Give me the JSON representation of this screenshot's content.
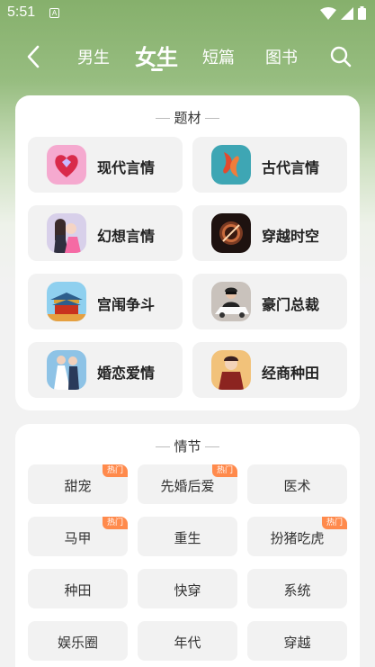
{
  "status_bar": {
    "time": "5:51",
    "app_badge": "A"
  },
  "nav": {
    "tabs": [
      {
        "label": "男生"
      },
      {
        "label": "女生"
      },
      {
        "label": "短篇"
      },
      {
        "label": "图书"
      }
    ],
    "active_tab": "女生"
  },
  "topics": {
    "title": "题材",
    "items": [
      {
        "label": "现代言情",
        "icon": "heart-gem-icon"
      },
      {
        "label": "古代言情",
        "icon": "koi-fish-icon"
      },
      {
        "label": "幻想言情",
        "icon": "couple-icon"
      },
      {
        "label": "穿越时空",
        "icon": "time-portal-icon"
      },
      {
        "label": "宫闱争斗",
        "icon": "palace-icon"
      },
      {
        "label": "豪门总裁",
        "icon": "ceo-car-icon"
      },
      {
        "label": "婚恋爱情",
        "icon": "wedding-icon"
      },
      {
        "label": "经商种田",
        "icon": "merchant-icon"
      }
    ]
  },
  "plots": {
    "title": "情节",
    "hot_label": "热门",
    "items": [
      {
        "label": "甜宠",
        "hot": true
      },
      {
        "label": "先婚后爱",
        "hot": true
      },
      {
        "label": "医术",
        "hot": false
      },
      {
        "label": "马甲",
        "hot": true
      },
      {
        "label": "重生",
        "hot": false
      },
      {
        "label": "扮猪吃虎",
        "hot": true
      },
      {
        "label": "种田",
        "hot": false
      },
      {
        "label": "快穿",
        "hot": false
      },
      {
        "label": "系统",
        "hot": false
      },
      {
        "label": "娱乐圈",
        "hot": false
      },
      {
        "label": "年代",
        "hot": false
      },
      {
        "label": "穿越",
        "hot": false
      }
    ]
  }
}
